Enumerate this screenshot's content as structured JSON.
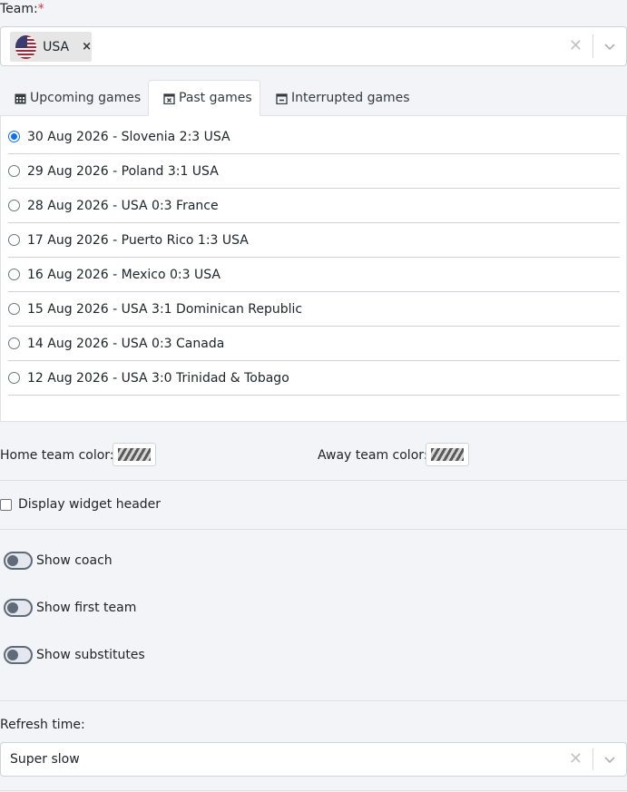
{
  "team": {
    "label": "Team:",
    "required_mark": "*",
    "selected_chip": "USA",
    "chip_remove": "×",
    "clear": "✕"
  },
  "tabs": [
    {
      "label": "Upcoming games",
      "icon": "calendar-icon",
      "active": false
    },
    {
      "label": "Past games",
      "icon": "calendar-x-icon",
      "active": true
    },
    {
      "label": "Interrupted games",
      "icon": "calendar-minus-icon",
      "active": false
    }
  ],
  "games": [
    {
      "label": "30 Aug 2026 - Slovenia 2:3 USA",
      "checked": true
    },
    {
      "label": "29 Aug 2026 - Poland 3:1 USA",
      "checked": false
    },
    {
      "label": "28 Aug 2026 - USA 0:3 France",
      "checked": false
    },
    {
      "label": "17 Aug 2026 - Puerto Rico 1:3 USA",
      "checked": false
    },
    {
      "label": "16 Aug 2026 - Mexico 0:3 USA",
      "checked": false
    },
    {
      "label": "15 Aug 2026 - USA 3:1 Dominican Republic",
      "checked": false
    },
    {
      "label": "14 Aug 2026 - USA 0:3 Canada",
      "checked": false
    },
    {
      "label": "12 Aug 2026 - USA 3:0 Trinidad & Tobago",
      "checked": false
    }
  ],
  "colors": {
    "home_label": "Home team color:",
    "away_label": "Away team color:"
  },
  "display_header": {
    "label": "Display widget header",
    "checked": false
  },
  "toggles": [
    {
      "label": "Show coach",
      "on": false
    },
    {
      "label": "Show first team",
      "on": false
    },
    {
      "label": "Show substitutes",
      "on": false
    }
  ],
  "refresh": {
    "label": "Refresh time:",
    "value": "Super slow",
    "clear": "✕"
  }
}
